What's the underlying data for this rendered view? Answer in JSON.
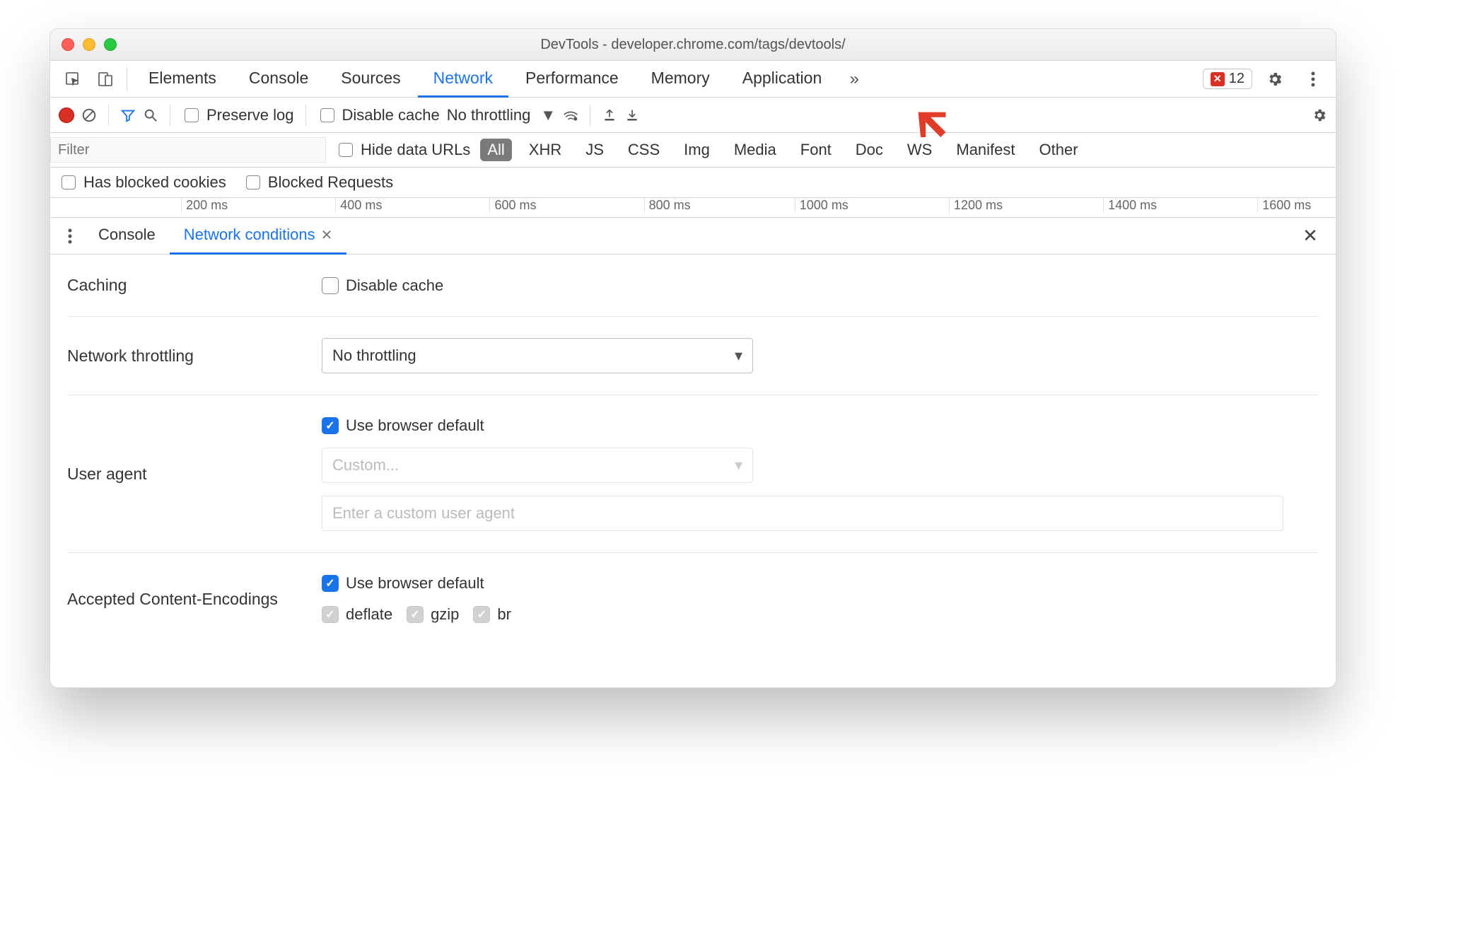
{
  "window": {
    "title": "DevTools - developer.chrome.com/tags/devtools/"
  },
  "tabs": {
    "items": [
      "Elements",
      "Console",
      "Sources",
      "Network",
      "Performance",
      "Memory",
      "Application"
    ],
    "active": "Network",
    "overflow_icon": "chevrons-right",
    "error_count": "12"
  },
  "network_toolbar": {
    "preserve_log": "Preserve log",
    "disable_cache": "Disable cache",
    "throttle": "No throttling"
  },
  "network_filters": {
    "filter_placeholder": "Filter",
    "hide_data_urls": "Hide data URLs",
    "types": [
      "All",
      "XHR",
      "JS",
      "CSS",
      "Img",
      "Media",
      "Font",
      "Doc",
      "WS",
      "Manifest",
      "Other"
    ],
    "active_type": "All"
  },
  "network_options": {
    "blocked_cookies": "Has blocked cookies",
    "blocked_requests": "Blocked Requests"
  },
  "timeline_ticks": [
    "200 ms",
    "400 ms",
    "600 ms",
    "800 ms",
    "1000 ms",
    "1200 ms",
    "1400 ms",
    "1600 ms"
  ],
  "drawer": {
    "tabs": {
      "console": "Console",
      "netcond": "Network conditions"
    },
    "sections": {
      "caching": {
        "label": "Caching",
        "disable_cache": "Disable cache"
      },
      "throttling": {
        "label": "Network throttling",
        "value": "No throttling"
      },
      "ua": {
        "label": "User agent",
        "use_default": "Use browser default",
        "custom_placeholder": "Custom...",
        "text_placeholder": "Enter a custom user agent"
      },
      "enc": {
        "label": "Accepted Content-Encodings",
        "use_default": "Use browser default",
        "options": {
          "deflate": "deflate",
          "gzip": "gzip",
          "br": "br"
        }
      }
    }
  }
}
